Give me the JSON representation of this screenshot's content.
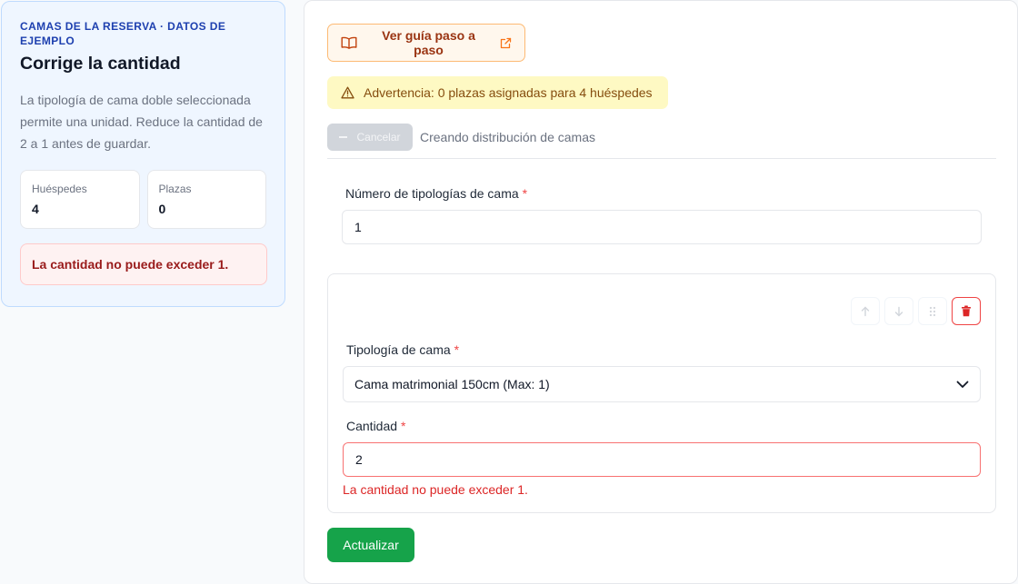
{
  "info": {
    "eyebrow": "CAMAS DE LA RESERVA · DATOS DE EJEMPLO",
    "title": "Corrige la cantidad",
    "description": "La tipología de cama doble seleccionada permite una unidad. Reduce la cantidad de 2 a 1 antes de guardar.",
    "stats": [
      {
        "label": "Huéspedes",
        "value": "4"
      },
      {
        "label": "Plazas",
        "value": "0"
      }
    ],
    "error": "La cantidad no puede exceder 1."
  },
  "main": {
    "guide_label": "Ver guía paso a paso",
    "warning_text": "Advertencia: 0 plazas asignadas para 4 huéspedes",
    "cancel_label": "Cancelar",
    "status_text": "Creando distribución de camas",
    "count_label": "Número de tipologías de cama",
    "required_mark": "*",
    "count_value": "1",
    "bed": {
      "type_label": "Tipología de cama",
      "type_value": "Cama matrimonial 150cm (Max: 1)",
      "quantity_label": "Cantidad",
      "quantity_value": "2",
      "quantity_error": "La cantidad no puede exceder 1."
    },
    "update_label": "Actualizar"
  },
  "colors": {
    "accent_blue": "#1e40af",
    "danger": "#dc2626",
    "warning_bg": "#fef9c3",
    "success": "#16a34a",
    "guide_orange": "#9a3412"
  },
  "icons": [
    "book-icon",
    "external-link-icon",
    "warning-icon",
    "arrow-up-icon",
    "arrow-down-icon",
    "drag-handle-icon",
    "trash-icon",
    "chevron-down-icon"
  ]
}
